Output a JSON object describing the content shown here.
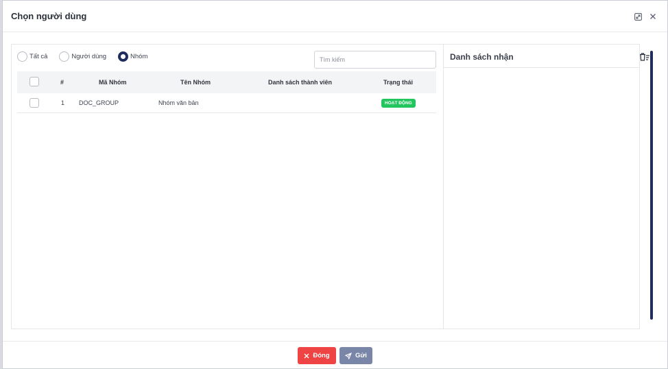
{
  "dialog": {
    "title": "Chọn người dùng",
    "expand_icon": "expand-icon",
    "close_icon": "close-icon"
  },
  "filter": {
    "options": [
      {
        "label": "Tất cả",
        "checked": false
      },
      {
        "label": "Người dùng",
        "checked": false
      },
      {
        "label": "Nhóm",
        "checked": true
      }
    ],
    "search_placeholder": "Tìm kiếm"
  },
  "table": {
    "columns": [
      "#",
      "Mã Nhóm",
      "Tên Nhóm",
      "Danh sách thành viên",
      "Trạng thái"
    ],
    "rows": [
      {
        "index": "1",
        "code": "DOC_GROUP",
        "name": "Nhóm văn bản",
        "members": "",
        "status": "HOẠT ĐỘNG"
      }
    ]
  },
  "recipients": {
    "title": "Danh sách nhận",
    "clear_icon": "trash-list-icon"
  },
  "footer": {
    "close_label": "Đóng",
    "send_label": "Gửi"
  },
  "colors": {
    "primary": "#1f2d5c",
    "danger": "#ef4444",
    "send": "#7a86a8",
    "status_active": "#22c55e"
  }
}
